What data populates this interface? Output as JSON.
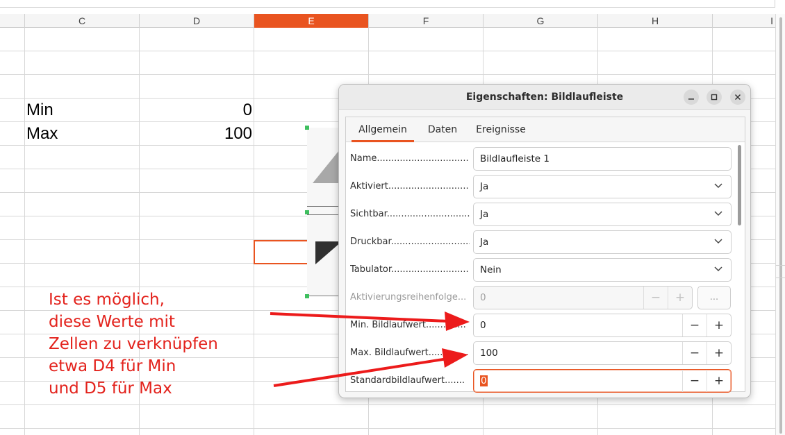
{
  "spreadsheet": {
    "columns": [
      "C",
      "D",
      "E",
      "F",
      "G",
      "H",
      "I"
    ],
    "selected_column": "E",
    "cells": {
      "C4": "Min",
      "D4": "0",
      "C5": "Max",
      "D5": "100"
    }
  },
  "annotation": {
    "lines": [
      "Ist es möglich,",
      "diese Werte mit",
      "Zellen zu verknüpfen",
      "etwa D4 für Min",
      "und D5 für Max"
    ],
    "color": "#e3221c"
  },
  "dialog": {
    "title": "Eigenschaften: Bildlaufleiste",
    "tabs": [
      "Allgemein",
      "Daten",
      "Ereignisse"
    ],
    "active_tab": "Allgemein",
    "fields": {
      "name": {
        "label": "Name.................................",
        "value": "Bildlaufleiste 1"
      },
      "aktiviert": {
        "label": "Aktiviert............................",
        "value": "Ja"
      },
      "sichtbar": {
        "label": "Sichtbar.............................",
        "value": "Ja"
      },
      "druckbar": {
        "label": "Druckbar............................",
        "value": "Ja"
      },
      "tabulator": {
        "label": "Tabulator...........................",
        "value": "Nein"
      },
      "aktivierungsreihenfolge": {
        "label": "Aktivierungsreihenfolge...",
        "value": "0",
        "button": "..."
      },
      "min_bildlaufwert": {
        "label": "Min. Bildlaufwert..............",
        "value": "0"
      },
      "max_bildlaufwert": {
        "label": "Max. Bildlaufwert..............",
        "value": "100"
      },
      "standardbildlaufwert": {
        "label": "Standardbildlaufwert.......",
        "value": "0"
      }
    },
    "spin_minus": "−",
    "spin_plus": "+"
  },
  "colors": {
    "accent": "#e95420",
    "selection_handle": "#3fbf5f"
  },
  "icons": {
    "minimize": "minimize-icon",
    "maximize": "maximize-icon",
    "close": "close-icon",
    "dropdown": "chevron-down-icon"
  }
}
